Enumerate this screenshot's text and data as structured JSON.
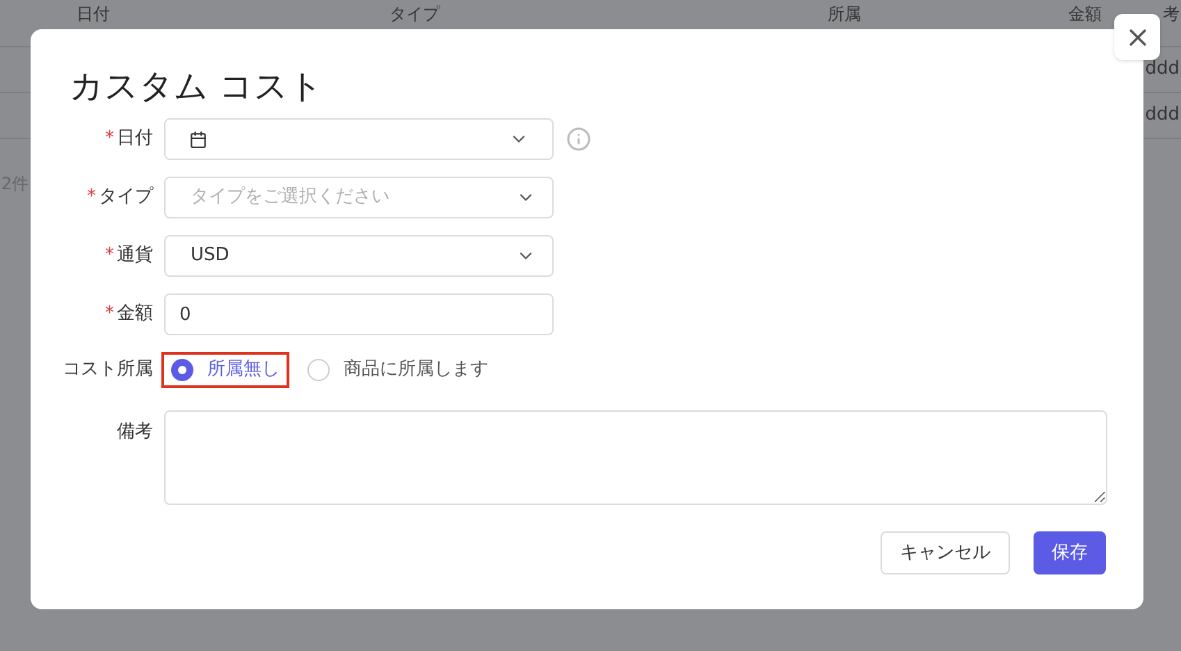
{
  "background_table": {
    "columns": [
      "日付",
      "タイプ",
      "所属",
      "金額",
      "考"
    ],
    "rows": [
      {
        "cell": "ddd"
      },
      {
        "cell": "ddd"
      }
    ],
    "footer": "2件"
  },
  "dialog": {
    "title": "カスタム コスト",
    "fields": [
      {
        "kind": "date",
        "label": "日付",
        "required_mark": "*"
      },
      {
        "kind": "select",
        "label": "タイプ",
        "required_mark": "*",
        "placeholder": "タイプをご選択ください"
      },
      {
        "kind": "select",
        "label": "通貨",
        "required_mark": "*",
        "value": "USD"
      },
      {
        "kind": "input",
        "label": "金額",
        "required_mark": "*",
        "value": "0"
      },
      {
        "kind": "radio",
        "label": "コスト所属",
        "options": [
          {
            "label": "所属無し",
            "selected": true,
            "highlighted": true
          },
          {
            "label": "商品に所属します",
            "selected": false,
            "highlighted": false
          }
        ]
      },
      {
        "kind": "textarea",
        "label": "備考"
      }
    ],
    "buttons": [
      {
        "label": "キャンセル",
        "kind": "secondary"
      },
      {
        "label": "保存",
        "kind": "primary"
      }
    ]
  }
}
